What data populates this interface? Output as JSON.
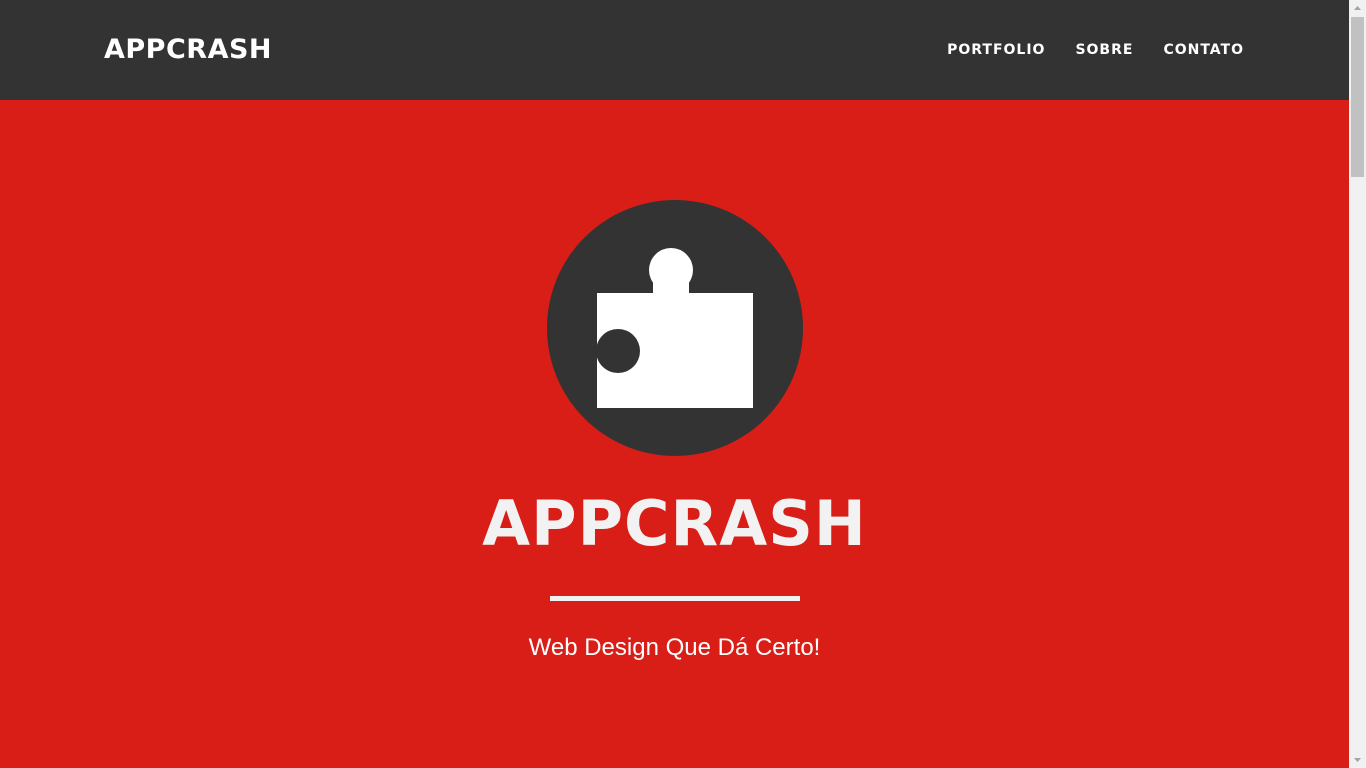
{
  "navbar": {
    "brand": "APPCRASH",
    "links": [
      {
        "label": "PORTFOLIO"
      },
      {
        "label": "SOBRE"
      },
      {
        "label": "CONTATO"
      }
    ]
  },
  "hero": {
    "icon": "puzzle-piece-icon",
    "title": "APPCRASH",
    "subtitle": "Web Design Que Dá Certo!"
  },
  "colors": {
    "navbar_bg": "#333333",
    "hero_bg": "#d81e17",
    "text": "#ffffff"
  }
}
